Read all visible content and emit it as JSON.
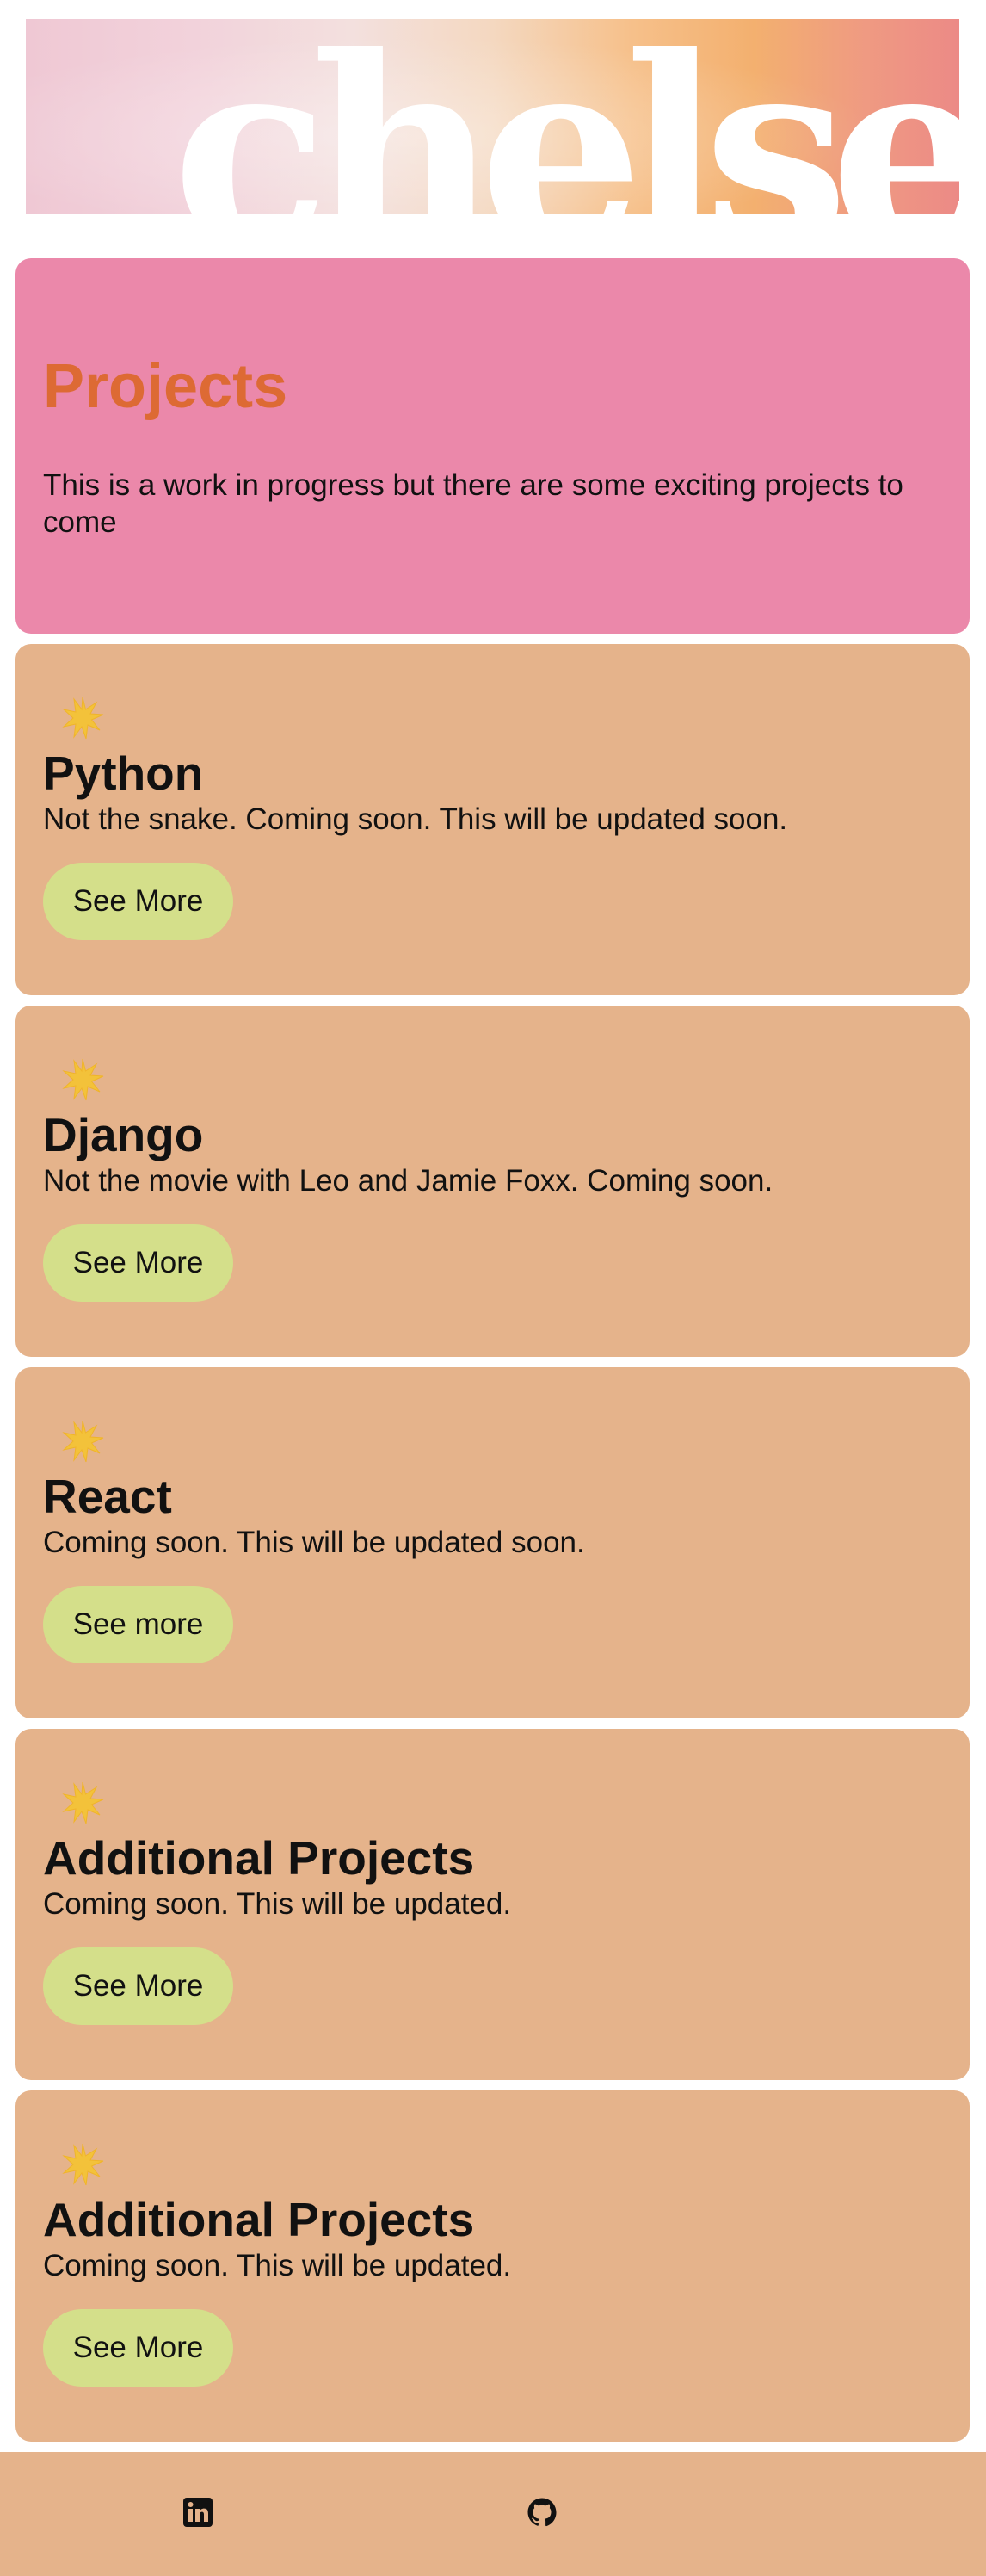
{
  "header": {
    "brand_word": "chelsea"
  },
  "intro": {
    "title": "Projects",
    "text": "This is a work in progress but there are some exciting projects to come"
  },
  "projects": [
    {
      "icon": "star-icon",
      "title": "Python",
      "description": "Not the snake. Coming soon. This will be updated soon.",
      "button_label": "See More"
    },
    {
      "icon": "star-icon",
      "title": "Django",
      "description": "Not the movie with Leo and Jamie Foxx. Coming soon.",
      "button_label": "See More"
    },
    {
      "icon": "star-icon",
      "title": "React",
      "description": "Coming soon. This will be updated soon.",
      "button_label": "See more"
    },
    {
      "icon": "star-icon",
      "title": "Additional Projects",
      "description": "Coming soon. This will be updated.",
      "button_label": "See More"
    },
    {
      "icon": "star-icon",
      "title": "Additional Projects",
      "description": "Coming soon. This will be updated.",
      "button_label": "See More"
    }
  ],
  "footer": {
    "icons": [
      "linkedin-icon",
      "github-icon"
    ]
  },
  "colors": {
    "intro_bg": "#eb88aa",
    "intro_title": "#dd6a34",
    "card_bg": "#e5b38b",
    "button_bg": "#d4df8a",
    "star": "#f3c23a"
  }
}
